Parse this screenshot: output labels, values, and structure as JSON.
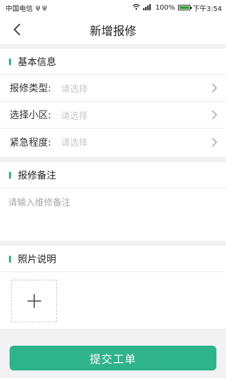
{
  "status_bar": {
    "carrier": "中国电信",
    "usb_icons": "ψ ψ",
    "battery_percent": "100%",
    "battery_level": 1.0,
    "time": "下午3:54"
  },
  "nav": {
    "title": "新增报修"
  },
  "basic_info": {
    "title": "基本信息",
    "rows": [
      {
        "label": "报修类型:",
        "value": "请选择"
      },
      {
        "label": "选择小区:",
        "value": "请选择"
      },
      {
        "label": "紧急程度:",
        "value": "请选择"
      }
    ]
  },
  "remark": {
    "title": "报修备注",
    "placeholder": "请输入维修备注"
  },
  "photos": {
    "title": "照片说明"
  },
  "submit": {
    "label": "提交工单"
  },
  "colors": {
    "accent": "#2fb38b"
  }
}
